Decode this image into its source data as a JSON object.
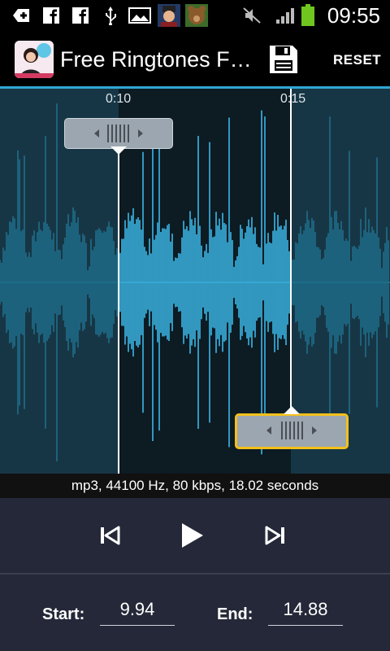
{
  "status_bar": {
    "time": "09:55",
    "icons": [
      "add-icon",
      "facebook-icon",
      "facebook-icon",
      "usb-icon",
      "image-icon",
      "game-avatar-icon",
      "bear-avatar-icon",
      "mute-icon",
      "signal-icon",
      "battery-icon"
    ]
  },
  "app_bar": {
    "title": "Free Ringtones F…",
    "reset_label": "RESET",
    "icon": "app-logo-icon",
    "save_icon": "save-icon"
  },
  "waveform": {
    "time_markers": [
      "0:10",
      "0:15"
    ],
    "colors": {
      "selected": "#3cb7e6",
      "unselected": "#1f6e8a",
      "background": "#173645",
      "highlight": "#f3c01a"
    }
  },
  "info": {
    "text": "mp3, 44100 Hz, 80 kbps, 18.02 seconds"
  },
  "controls": {
    "prev_icon": "skip-previous-icon",
    "play_icon": "play-icon",
    "next_icon": "skip-next-icon"
  },
  "fields": {
    "start_label": "Start:",
    "start_value": "9.94",
    "end_label": "End:",
    "end_value": "14.88"
  }
}
